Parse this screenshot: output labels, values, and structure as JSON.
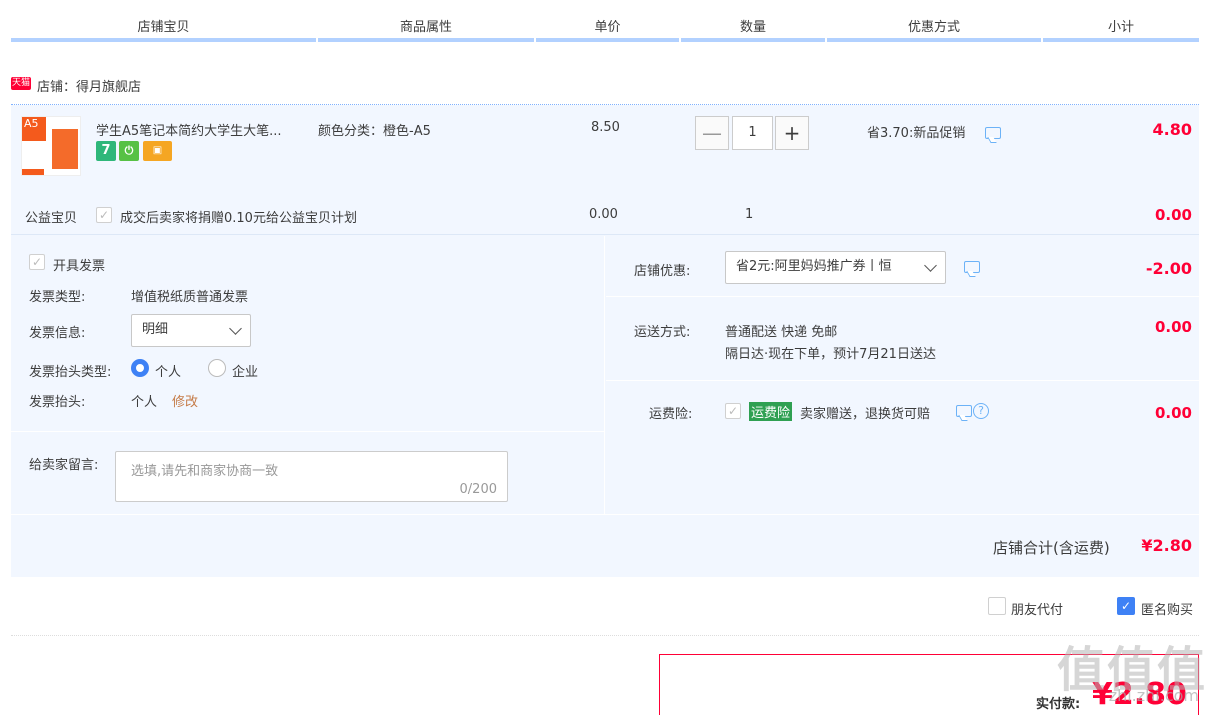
{
  "header": {
    "col_shop_item": "店铺宝贝",
    "col_attr": "商品属性",
    "col_price": "单价",
    "col_qty": "数量",
    "col_promo": "优惠方式",
    "col_subtotal": "小计"
  },
  "shop": {
    "badge": "天猫",
    "label": "店铺：得月旗舰店"
  },
  "item": {
    "thumb_text": "A5",
    "title": "学生A5笔记本简约大学生大笔...",
    "attr": "颜色分类：橙色-A5",
    "price": "8.50",
    "qty": "1",
    "qty_minus": "—",
    "qty_plus": "+",
    "promo": "省3.70:新品促销",
    "subtotal": "4.80",
    "service_icons": [
      "seven-day-return-icon",
      "plug-icon",
      "card-icon"
    ],
    "seven_label": "7"
  },
  "charity": {
    "label": "公益宝贝",
    "text": "成交后卖家将捐赠0.10元给公益宝贝计划",
    "price": "0.00",
    "qty": "1",
    "subtotal": "0.00"
  },
  "invoice": {
    "issue_label": "开具发票",
    "type_label": "发票类型:",
    "type_value": "增值税纸质普通发票",
    "info_label": "发票信息:",
    "info_value": "明细",
    "title_type_label": "发票抬头类型:",
    "title_type_personal": "个人",
    "title_type_company": "企业",
    "title_label": "发票抬头:",
    "title_value": "个人",
    "edit": "修改"
  },
  "message": {
    "label": "给卖家留言:",
    "placeholder": "选填,请先和商家协商一致",
    "counter": "0/200"
  },
  "discount": {
    "label": "店铺优惠:",
    "value": "省2元:阿里妈妈推广券丨恒",
    "amount": "-2.00"
  },
  "shipping": {
    "label": "运送方式:",
    "line1": "普通配送 快递 免邮",
    "line2": "隔日达·现在下单，预计7月21日送达",
    "amount": "0.00"
  },
  "insurance": {
    "label": "运费险:",
    "badge": "运费险",
    "text": "卖家赠送，退换货可赔",
    "help": "?",
    "amount": "0.00"
  },
  "total": {
    "label": "店铺合计(含运费)",
    "value": "¥2.80"
  },
  "options": {
    "friend_pay": "朋友代付",
    "anonymous": "匿名购买"
  },
  "final": {
    "label": "实付款:",
    "value": "¥2.80"
  },
  "watermark": {
    "logo": "值值值",
    "site": "zhi.zhi.com"
  },
  "colors": {
    "accent_blue": "#3e81f5",
    "price_red": "#ff0036",
    "light_bg": "#f2f7ff",
    "header_bar": "#b2d1ff",
    "edit_orange": "#c57b48",
    "insurance_green": "#2fa052"
  }
}
